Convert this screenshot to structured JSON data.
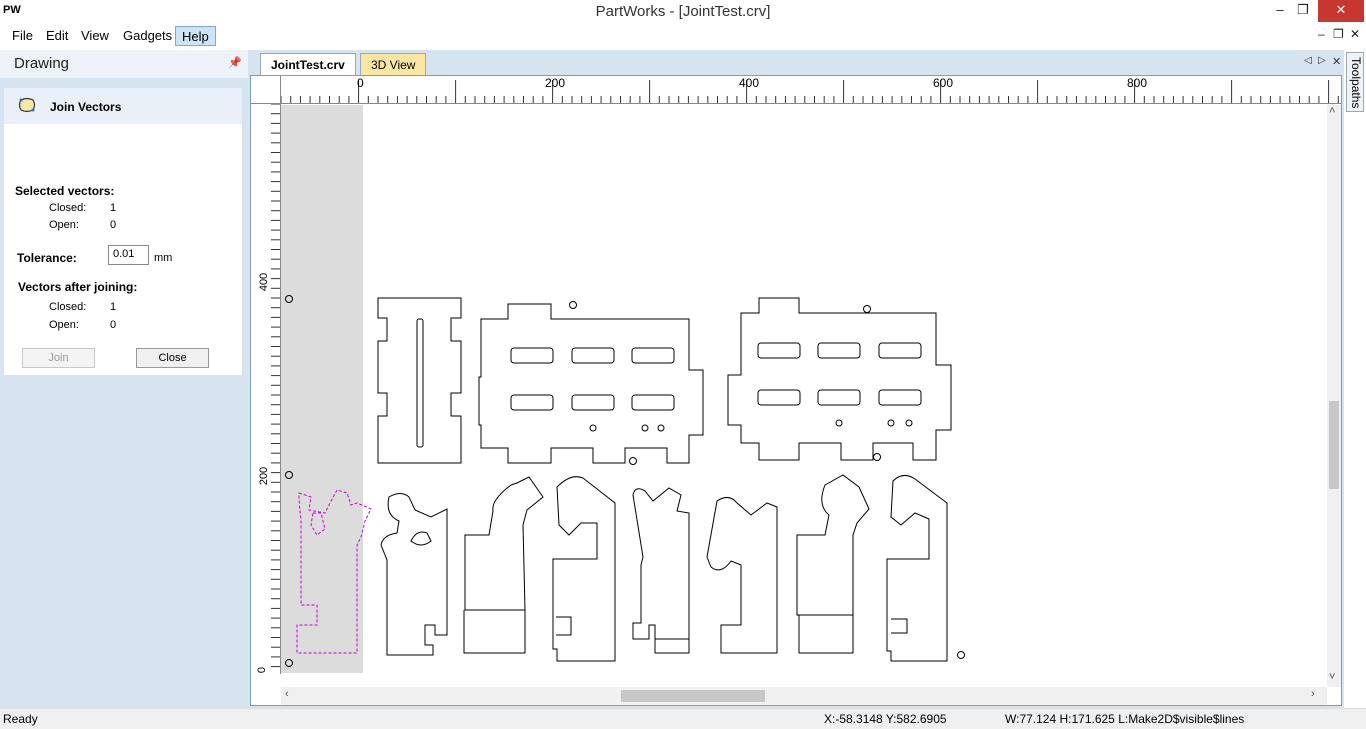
{
  "app": {
    "logo": "PW",
    "title": "PartWorks - [JointTest.crv]",
    "window_controls": {
      "minimize": "–",
      "restore": "❐",
      "close": "✕"
    },
    "mdi_controls": {
      "minimize": "–",
      "restore": "❐",
      "close": "✕"
    }
  },
  "menu": {
    "items": [
      "File",
      "Edit",
      "View",
      "Gadgets",
      "Help"
    ],
    "active": "Help"
  },
  "left_panel": {
    "title": "Drawing",
    "pin": "📌",
    "tool": {
      "title": "Join Vectors",
      "selected_heading": "Selected vectors:",
      "closed_label": "Closed:",
      "closed_value": "1",
      "open_label": "Open:",
      "open_value": "0",
      "tolerance_label": "Tolerance:",
      "tolerance_value": "0.01",
      "tolerance_unit": "mm",
      "after_heading": "Vectors after joining:",
      "after_closed_label": "Closed:",
      "after_closed_value": "1",
      "after_open_label": "Open:",
      "after_open_value": "0",
      "join_label": "Join",
      "close_label": "Close"
    }
  },
  "tabs": [
    {
      "label": "JointTest.crv",
      "active": true
    },
    {
      "label": "3D View",
      "active": false
    }
  ],
  "tab_nav": {
    "prev": "◁",
    "next": "▷",
    "close": "✕"
  },
  "rulers": {
    "top_labels": [
      "0",
      "200",
      "400",
      "600",
      "800"
    ],
    "left_labels": [
      "400",
      "200",
      "0"
    ]
  },
  "scroll": {
    "up": "˄",
    "down": "˅",
    "left": "‹",
    "right": "›"
  },
  "right_tab": "Toolpaths",
  "status": {
    "ready": "Ready",
    "coords": "X:-58.3148 Y:582.6905",
    "size": "W:77.124   H:171.625  L:Make2D$visible$lines"
  },
  "colors": {
    "selected_vector": "#cc00cc",
    "panel_bg": "#d6e4f1",
    "margin_gray": "#dcdcdc"
  }
}
